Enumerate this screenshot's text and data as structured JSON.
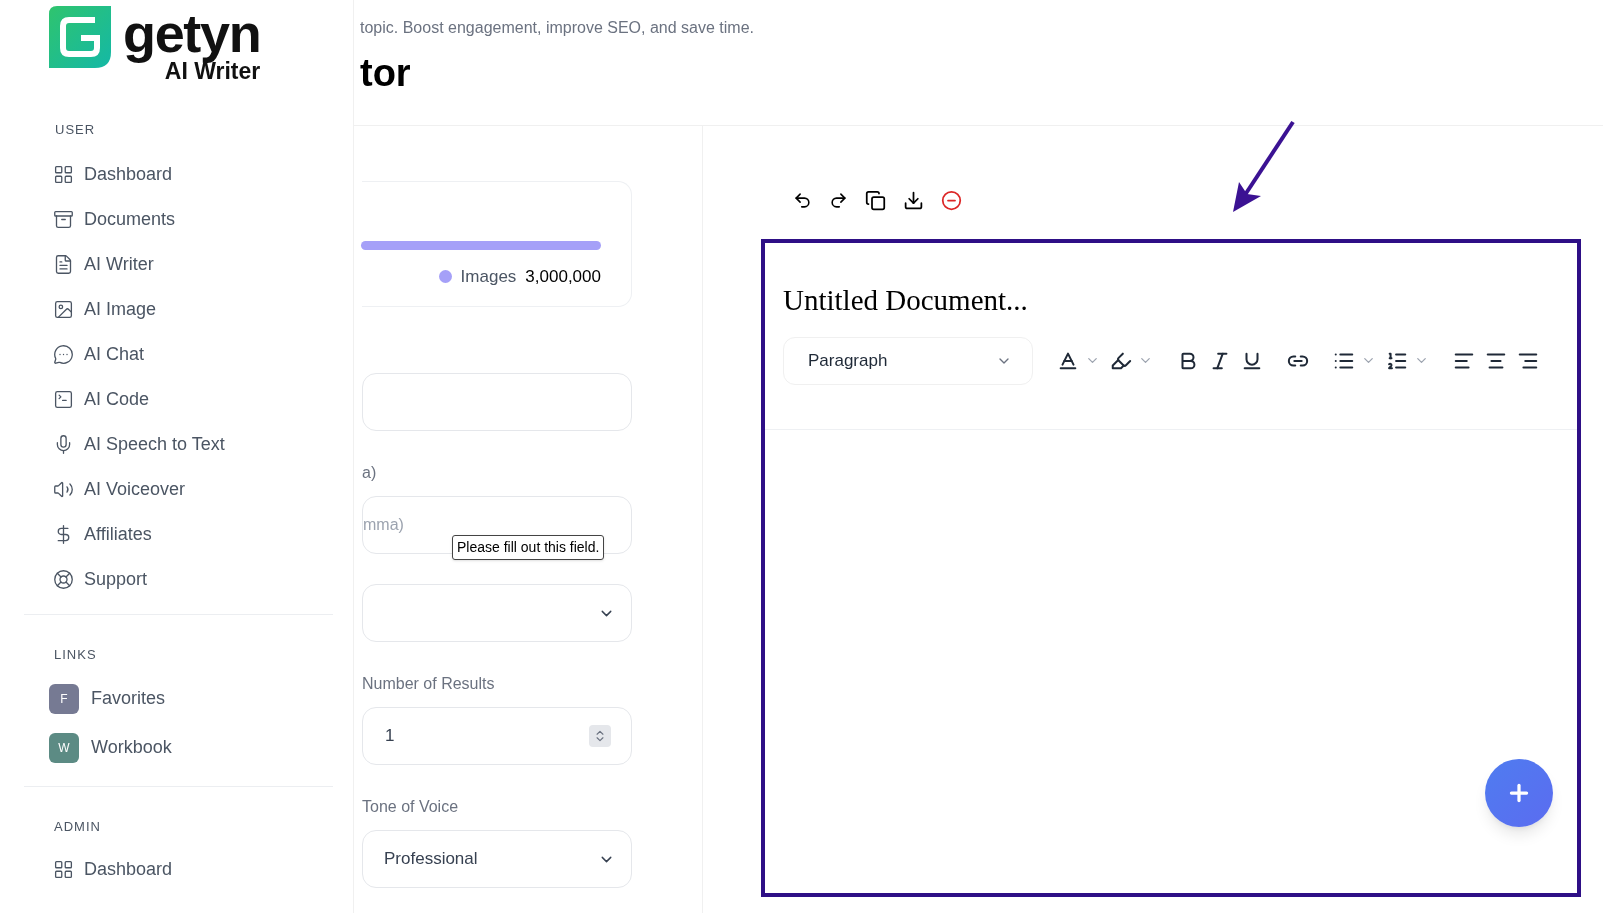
{
  "logo": {
    "name": "getyn",
    "subtitle": "AI Writer"
  },
  "sidebar": {
    "sections": [
      {
        "title": "USER",
        "items": [
          {
            "label": "Dashboard"
          },
          {
            "label": "Documents"
          },
          {
            "label": "AI Writer"
          },
          {
            "label": "AI Image"
          },
          {
            "label": "AI Chat"
          },
          {
            "label": "AI Code"
          },
          {
            "label": "AI Speech to Text"
          },
          {
            "label": "AI Voiceover"
          },
          {
            "label": "Affiliates"
          },
          {
            "label": "Support"
          }
        ]
      },
      {
        "title": "LINKS",
        "items": [
          {
            "label": "Favorites",
            "letter": "F",
            "color": "#767a93"
          },
          {
            "label": "Workbook",
            "letter": "W",
            "color": "#5c8b84"
          }
        ]
      },
      {
        "title": "ADMIN",
        "items": [
          {
            "label": "Dashboard"
          }
        ]
      }
    ]
  },
  "header": {
    "description": "topic. Boost engagement, improve SEO, and save time.",
    "title": "tor"
  },
  "usage": {
    "legend": "Images",
    "value": "3,000,000",
    "color": "#a5a0f8"
  },
  "form": [
    {
      "kind": "text"
    },
    {
      "kind": "text",
      "label": "a)",
      "placeholder": "mma)",
      "tooltip": "Please fill out this field."
    },
    {
      "kind": "select"
    },
    {
      "kind": "number",
      "label": "Number of Results",
      "value": "1"
    },
    {
      "kind": "select",
      "label": "Tone of Voice",
      "value": "Professional"
    }
  ],
  "editor": {
    "title": "Untitled Document...",
    "block_type": "Paragraph"
  }
}
